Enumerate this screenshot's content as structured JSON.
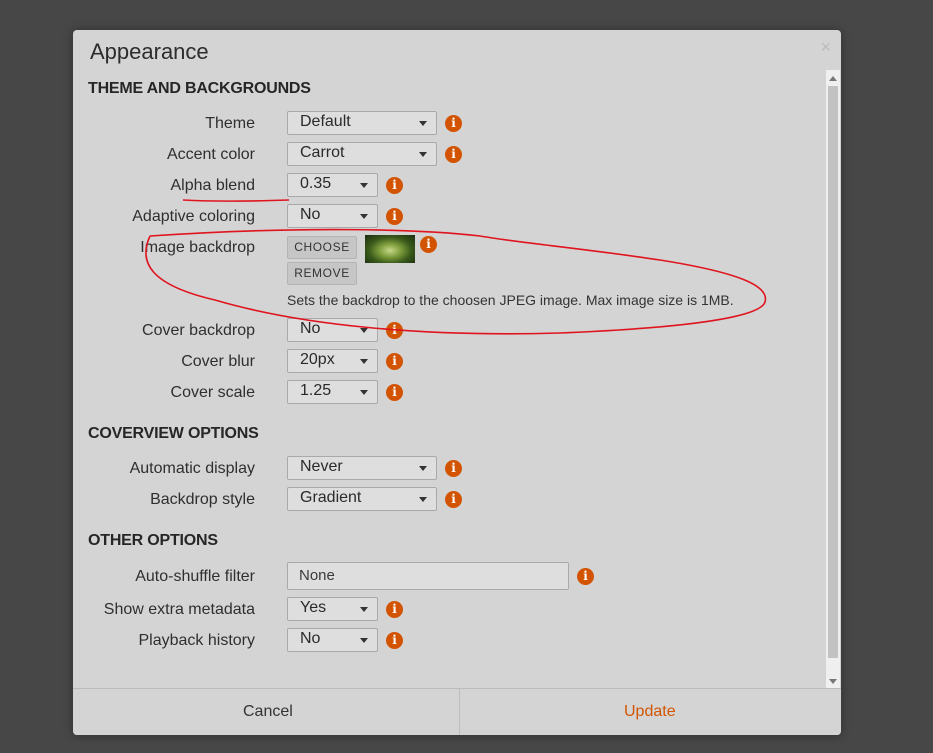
{
  "dialog": {
    "title": "Appearance",
    "close_glyph": "×",
    "sections": {
      "theme": "THEME AND BACKGROUNDS",
      "coverview": "COVERVIEW OPTIONS",
      "other": "OTHER OPTIONS"
    },
    "settings": {
      "theme": {
        "label": "Theme",
        "value": "Default"
      },
      "accent_color": {
        "label": "Accent color",
        "value": "Carrot"
      },
      "alpha_blend": {
        "label": "Alpha blend",
        "value": "0.35"
      },
      "adaptive_coloring": {
        "label": "Adaptive coloring",
        "value": "No"
      },
      "image_backdrop": {
        "label": "Image backdrop",
        "choose": "CHOOSE",
        "remove": "REMOVE",
        "hint": "Sets the backdrop to the choosen JPEG image. Max image size is 1MB."
      },
      "cover_backdrop": {
        "label": "Cover backdrop",
        "value": "No"
      },
      "cover_blur": {
        "label": "Cover blur",
        "value": "20px"
      },
      "cover_scale": {
        "label": "Cover scale",
        "value": "1.25"
      },
      "automatic_display": {
        "label": "Automatic display",
        "value": "Never"
      },
      "backdrop_style": {
        "label": "Backdrop style",
        "value": "Gradient"
      },
      "auto_shuffle_filter": {
        "label": "Auto-shuffle filter",
        "value": "None"
      },
      "show_extra_metadata": {
        "label": "Show extra metadata",
        "value": "Yes"
      },
      "playback_history": {
        "label": "Playback history",
        "value": "No"
      }
    },
    "info_glyph": "i",
    "footer": {
      "cancel": "Cancel",
      "update": "Update"
    }
  },
  "colors": {
    "accent": "#d35400",
    "backdrop": "#474747",
    "dialog_bg": "#d4d4d4",
    "annotation": "#e0141e"
  },
  "icons": [
    "info-icon",
    "chevron-down-icon",
    "close-icon"
  ]
}
